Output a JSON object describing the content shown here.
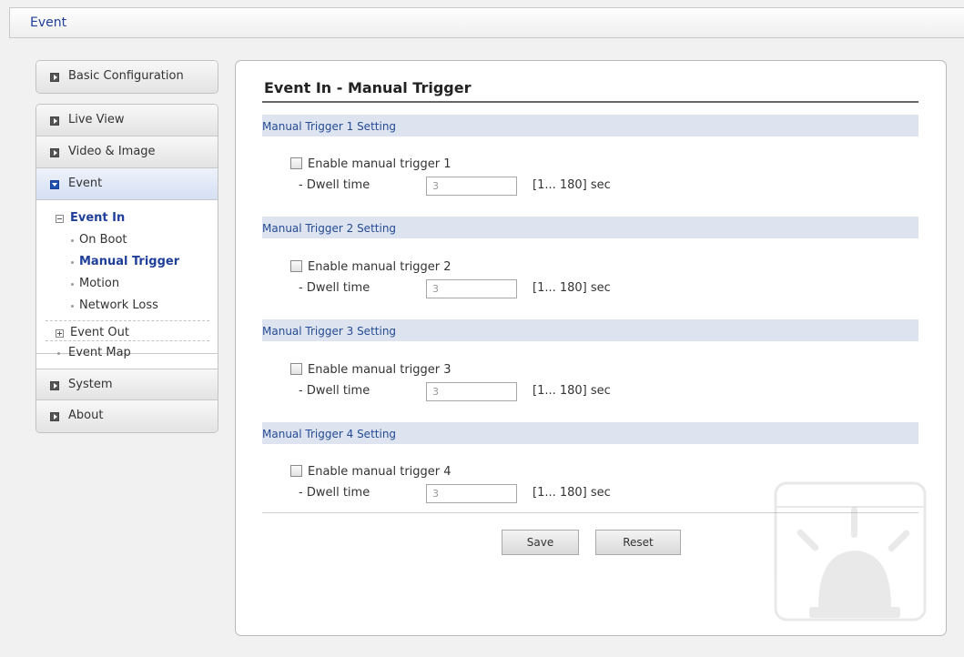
{
  "window": {
    "title": "Event"
  },
  "sidebar": {
    "top_item": "Basic Configuration",
    "items": [
      "Live View",
      "Video & Image",
      "Event"
    ],
    "event_in": {
      "label": "Event In",
      "children": [
        "On Boot",
        "Manual Trigger",
        "Motion",
        "Network Loss"
      ]
    },
    "event_out": "Event Out",
    "event_map": "Event Map",
    "bottom_items": [
      "System",
      "About"
    ]
  },
  "content": {
    "title": "Event In - Manual Trigger",
    "sections": [
      {
        "header": "Manual Trigger 1 Setting",
        "checkbox_label": "Enable manual trigger 1",
        "dwell_label": "- Dwell time",
        "dwell_value": "3",
        "range": "[1... 180] sec",
        "checked": false
      },
      {
        "header": "Manual Trigger 2 Setting",
        "checkbox_label": "Enable manual trigger 2",
        "dwell_label": "- Dwell time",
        "dwell_value": "3",
        "range": "[1... 180] sec",
        "checked": false
      },
      {
        "header": "Manual Trigger 3 Setting",
        "checkbox_label": "Enable manual trigger 3",
        "dwell_label": "- Dwell time",
        "dwell_value": "3",
        "range": "[1... 180] sec",
        "checked": false
      },
      {
        "header": "Manual Trigger 4 Setting",
        "checkbox_label": "Enable manual trigger 4",
        "dwell_label": "- Dwell time",
        "dwell_value": "3",
        "range": "[1... 180] sec",
        "checked": false
      }
    ],
    "buttons": {
      "save": "Save",
      "reset": "Reset"
    }
  },
  "icons": {
    "decorative_watermark": "alarm-siren-icon"
  },
  "colors": {
    "accent": "#1f3f9a",
    "section_header_bg": "#dde4ef",
    "active_nav_bg": "#d5dff3"
  }
}
